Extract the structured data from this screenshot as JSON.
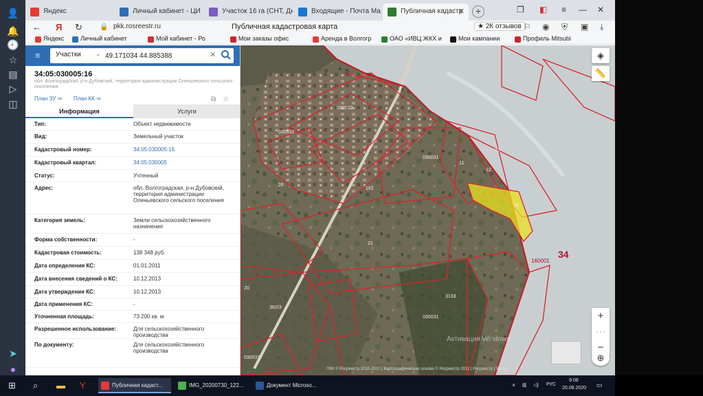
{
  "browser": {
    "tabs": [
      {
        "label": "Яндекс",
        "color": "#e53935"
      },
      {
        "label": "Личный кабинет - ЦИ",
        "color": "#2f6db5"
      },
      {
        "label": "Участок 16 га (СНТ, Дн",
        "color": "#7a5cc2"
      },
      {
        "label": "Входящие - Почта Ма",
        "color": "#1976d2"
      },
      {
        "label": "Публичная кадастр",
        "color": "#2e7d32"
      }
    ],
    "url": "pkk.rosreestr.ru",
    "page_title": "Публичная кадастровая карта",
    "rating_badge": "★ 2К отзывов",
    "bookmarks": [
      {
        "label": "Яндекс",
        "color": "#e53935"
      },
      {
        "label": "Личный кабинет",
        "color": "#2f6db5"
      },
      {
        "label": "Мой кабинет - Ро",
        "color": "#d32f2f"
      },
      {
        "label": "Мои заказы офис",
        "color": "#c62828"
      },
      {
        "label": "Аренда в Волгогр",
        "color": "#e53935"
      },
      {
        "label": "ОАО «ИВЦ ЖКХ и",
        "color": "#2e7d32"
      },
      {
        "label": "Мои кампании",
        "color": "#111111"
      },
      {
        "label": "Профиль Mitsubi",
        "color": "#c62828"
      }
    ]
  },
  "search": {
    "category": "Участки",
    "query": "49.171034 44.885388"
  },
  "parcel": {
    "cadastral_number": "34:05:030005:16",
    "address_short": "обл. Волгоградская, р-н Дубовский, территория администрации Оленьевского сельского поселения",
    "plan_zu": "План ЗУ ⇒",
    "plan_kk": "План КК ⇒",
    "tab_info": "Информация",
    "tab_services": "Услуги",
    "rows": [
      {
        "label": "Тип:",
        "value": "Объект недвижимости",
        "link": false
      },
      {
        "label": "Вид:",
        "value": "Земельный участок",
        "link": false
      },
      {
        "label": "Кадастровый номер:",
        "value": "34:05:030005:16",
        "link": true
      },
      {
        "label": "Кадастровый квартал:",
        "value": "34:05:030005",
        "link": true
      },
      {
        "label": "Статус:",
        "value": "Учтенный",
        "link": false
      },
      {
        "label": "Адрес:",
        "value": "обл. Волгоградская, р-н Дубовский, территория администрации Оленьевского сельского поселения",
        "link": false
      },
      {
        "label": "Категория земель:",
        "value": "Земли сельскохозяйственного назначения",
        "link": false
      },
      {
        "label": "Форма собственности:",
        "value": "-",
        "link": false
      },
      {
        "label": "Кадастровая стоимость:",
        "value": "138 348 руб.",
        "link": false
      },
      {
        "label": "Дата определения КС:",
        "value": "01.01.2011",
        "link": false
      },
      {
        "label": "Дата внесения сведений о КС:",
        "value": "10.12.2013",
        "link": false
      },
      {
        "label": "Дата утверждения КС:",
        "value": "10.12.2013",
        "link": false
      },
      {
        "label": "Дата применения КС:",
        "value": "-",
        "link": false
      },
      {
        "label": "Уточненная площадь:",
        "value": "73 200 кв. м",
        "link": false
      },
      {
        "label": "Разрешенное использование:",
        "value": "Для сельскохозяйственного производства",
        "link": false
      },
      {
        "label": "По документу:",
        "value": "Для сельскохозяйственного производства",
        "link": false
      }
    ]
  },
  "map": {
    "zone_number": "34",
    "zone_code": "160001",
    "watermark": "Активация Windows",
    "copyright": "ПКК © Росреестр 2010-2020 | Картографическая основа © Росреестр 2011 | Росреестр | Яндекс",
    "labels": [
      "030032",
      "030032",
      "030031",
      "030031",
      "030031",
      "16",
      "12",
      "11",
      "72",
      "161",
      "21",
      "26",
      "362/3",
      "3133",
      "20"
    ]
  },
  "taskbar": {
    "items": [
      {
        "label": "Публичная кадаст...",
        "color": "#e53935"
      },
      {
        "label": "IMG_20200730_122...",
        "color": "#4caf50"
      },
      {
        "label": "Документ Microso...",
        "color": "#2b579a"
      }
    ],
    "lang": "РУС",
    "time": "9:08",
    "date": "20.08.2020"
  }
}
